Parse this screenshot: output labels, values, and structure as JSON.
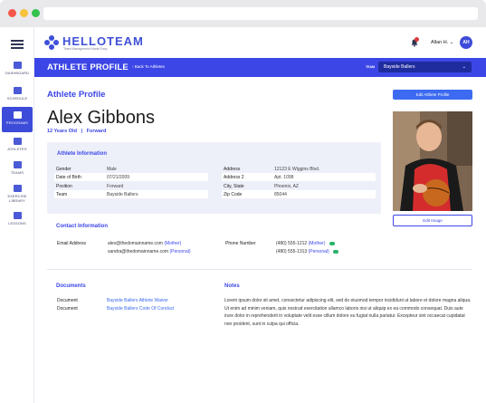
{
  "app": {
    "logo_text": "HELLOTEAM",
    "logo_tagline": "Team Management Made Easy"
  },
  "sidebar": {
    "items": [
      {
        "label": "DASHBOARD",
        "icon": "dashboard-icon"
      },
      {
        "label": "SCHEDULE",
        "icon": "calendar-icon"
      },
      {
        "label": "PROGRAMS",
        "icon": "programs-icon",
        "active": true
      },
      {
        "label": "ATHLETES",
        "icon": "athletes-icon"
      },
      {
        "label": "TEAMS",
        "icon": "teams-icon"
      },
      {
        "label": "EXERCISE LIBRARY",
        "icon": "exercise-icon"
      },
      {
        "label": "LESSONS",
        "icon": "lessons-icon"
      }
    ]
  },
  "topbar": {
    "user_name": "Allan H.",
    "avatar_initials": "AH",
    "notification_icon": "bell-icon"
  },
  "header": {
    "title": "ATHLETE PROFILE",
    "back_link": "‹  Back To Athletes",
    "team_label": "TEAM",
    "team_value": "Bayside Ballers"
  },
  "profile": {
    "section_title": "Athlete Profile",
    "edit_button": "Edit Athlete Profile",
    "name": "Alex Gibbons",
    "age": "12 Years Old",
    "separator": "|",
    "position": "Forward",
    "edit_image_button": "Edit Image"
  },
  "athlete_info": {
    "title": "Athlete Information",
    "left": [
      {
        "key": "Gender",
        "value": "Male"
      },
      {
        "key": "Date of Birth",
        "value": "07/21/2009"
      },
      {
        "key": "Position",
        "value": "Forward"
      },
      {
        "key": "Team",
        "value": "Bayside Ballers"
      }
    ],
    "right": [
      {
        "key": "Address",
        "value": "12123 E Wiggins Blvd."
      },
      {
        "key": "Address 2",
        "value": "Apt. 1098"
      },
      {
        "key": "City, State",
        "value": "Phoenix, AZ"
      },
      {
        "key": "Zip Code",
        "value": "85044"
      }
    ]
  },
  "contact": {
    "title": "Contact Information",
    "email_label": "Email Address",
    "emails": [
      {
        "value": "alex@thedomainname.com",
        "tag": "(Mother)"
      },
      {
        "value": "sandra@thedomainname.com",
        "tag": "(Personal)"
      }
    ],
    "phone_label": "Phone Number",
    "phones": [
      {
        "value": "(480) 555-1212",
        "tag": "(Mother)"
      },
      {
        "value": "(480) 555-1313",
        "tag": "(Personal)"
      }
    ]
  },
  "documents": {
    "title": "Documents",
    "items": [
      {
        "key": "Document",
        "value": "Bayside Ballers Athlete Waiver"
      },
      {
        "key": "Document",
        "value": "Bayside Ballers Code Of Conduct"
      }
    ]
  },
  "notes": {
    "title": "Notes",
    "text": "Lorem ipsum dolor sit amet, consectetur adipiscing elit, sed do eiusmod tempor incididunt ut labore et dolore magna aliqua. Ut enim ad minim veniam, quis nostrud exercitation ullamco laboris nisi ut aliquip ex ea commodo consequat. Duis aute irure dolor in reprehenderit in voluptate velit esse cillum dolore eu fugiat nulla pariatur. Excepteur sint occaecat cupidatat non proident, sunt in culpa qui officia."
  },
  "colors": {
    "accent": "#3c46e6",
    "sidebar_active": "#3c4bd8",
    "chat_green": "#29b36a"
  }
}
